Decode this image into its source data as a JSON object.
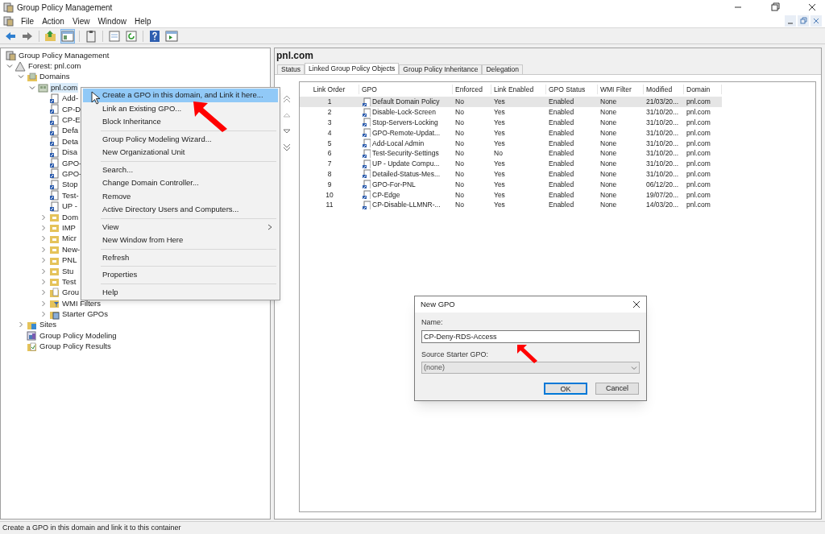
{
  "window": {
    "title": "Group Policy Management"
  },
  "menu_bar": [
    "File",
    "Action",
    "View",
    "Window",
    "Help"
  ],
  "toolbar": [
    {
      "kind": "back",
      "pressed": false
    },
    {
      "kind": "forward",
      "pressed": false
    },
    {
      "kind": "sep"
    },
    {
      "kind": "up",
      "pressed": false
    },
    {
      "kind": "tree",
      "pressed": true
    },
    {
      "kind": "sep"
    },
    {
      "kind": "clipboard",
      "pressed": false
    },
    {
      "kind": "sep"
    },
    {
      "kind": "export",
      "pressed": false
    },
    {
      "kind": "refresh",
      "pressed": false
    },
    {
      "kind": "sep"
    },
    {
      "kind": "help",
      "pressed": false
    },
    {
      "kind": "pane",
      "pressed": false
    }
  ],
  "tree": [
    {
      "label": "Group Policy Management",
      "kind": "root",
      "selected": false,
      "children": [
        {
          "label": "Forest: pnl.com",
          "kind": "forest",
          "expanded": true,
          "selected": false,
          "children": [
            {
              "label": "Domains",
              "kind": "domains",
              "expanded": true,
              "selected": false,
              "children": [
                {
                  "label": "pnl.com",
                  "kind": "domain",
                  "expanded": true,
                  "selected": true,
                  "children": [
                    {
                      "label": "Add-",
                      "kind": "link",
                      "selected": false
                    },
                    {
                      "label": "CP-D",
                      "kind": "link",
                      "selected": false
                    },
                    {
                      "label": "CP-E",
                      "kind": "link",
                      "selected": false
                    },
                    {
                      "label": "Defa",
                      "kind": "link",
                      "selected": false
                    },
                    {
                      "label": "Deta",
                      "kind": "link",
                      "selected": false
                    },
                    {
                      "label": "Disa",
                      "kind": "link",
                      "selected": false
                    },
                    {
                      "label": "GPO-",
                      "kind": "link",
                      "selected": false
                    },
                    {
                      "label": "GPO-",
                      "kind": "link",
                      "selected": false
                    },
                    {
                      "label": "Stop",
                      "kind": "link",
                      "selected": false
                    },
                    {
                      "label": "Test-",
                      "kind": "link",
                      "selected": false
                    },
                    {
                      "label": "UP -",
                      "kind": "link",
                      "selected": false
                    },
                    {
                      "label": "Dom",
                      "kind": "ou",
                      "expanded": false,
                      "selected": false
                    },
                    {
                      "label": "IMP",
                      "kind": "ou",
                      "expanded": false,
                      "selected": false
                    },
                    {
                      "label": "Micr",
                      "kind": "ou",
                      "expanded": false,
                      "selected": false
                    },
                    {
                      "label": "New-",
                      "kind": "ou",
                      "expanded": false,
                      "selected": false
                    },
                    {
                      "label": "PNL",
                      "kind": "ou",
                      "expanded": false,
                      "selected": false
                    },
                    {
                      "label": "Stu",
                      "kind": "ou",
                      "expanded": false,
                      "selected": false
                    },
                    {
                      "label": "Test",
                      "kind": "ou",
                      "expanded": false,
                      "selected": false
                    },
                    {
                      "label": "Grou",
                      "kind": "gpofolder",
                      "expanded": false,
                      "selected": false
                    },
                    {
                      "label": "WMI Filters",
                      "kind": "wmi",
                      "expanded": false,
                      "selected": false
                    },
                    {
                      "label": "Starter GPOs",
                      "kind": "starter",
                      "expanded": false,
                      "selected": false
                    }
                  ]
                }
              ]
            },
            {
              "label": "Sites",
              "kind": "sites",
              "expanded": false,
              "selected": false
            },
            {
              "label": "Group Policy Modeling",
              "kind": "modeling",
              "selected": false
            },
            {
              "label": "Group Policy Results",
              "kind": "results",
              "selected": false
            }
          ]
        }
      ]
    }
  ],
  "details": {
    "title": "pnl.com",
    "tabs": [
      {
        "label": "Status",
        "selected": false
      },
      {
        "label": "Linked Group Policy Objects",
        "selected": true
      },
      {
        "label": "Group Policy Inheritance",
        "selected": false
      },
      {
        "label": "Delegation",
        "selected": false
      }
    ],
    "columns": [
      "Link Order",
      "GPO",
      "Enforced",
      "Link Enabled",
      "GPO Status",
      "WMI Filter",
      "Modified",
      "Domain"
    ],
    "rows": [
      {
        "selected": true,
        "cells": [
          "1",
          "Default Domain Policy",
          "No",
          "Yes",
          "Enabled",
          "None",
          "21/03/20...",
          "pnl.com"
        ]
      },
      {
        "selected": false,
        "cells": [
          "2",
          "Disable-Lock-Screen",
          "No",
          "Yes",
          "Enabled",
          "None",
          "31/10/20...",
          "pnl.com"
        ]
      },
      {
        "selected": false,
        "cells": [
          "3",
          "Stop-Servers-Locking",
          "No",
          "Yes",
          "Enabled",
          "None",
          "31/10/20...",
          "pnl.com"
        ]
      },
      {
        "selected": false,
        "cells": [
          "4",
          "GPO-Remote-Updat...",
          "No",
          "Yes",
          "Enabled",
          "None",
          "31/10/20...",
          "pnl.com"
        ]
      },
      {
        "selected": false,
        "cells": [
          "5",
          "Add-Local Admin",
          "No",
          "Yes",
          "Enabled",
          "None",
          "31/10/20...",
          "pnl.com"
        ]
      },
      {
        "selected": false,
        "cells": [
          "6",
          "Test-Security-Settings",
          "No",
          "No",
          "Enabled",
          "None",
          "31/10/20...",
          "pnl.com"
        ]
      },
      {
        "selected": false,
        "cells": [
          "7",
          "UP - Update Compu...",
          "No",
          "Yes",
          "Enabled",
          "None",
          "31/10/20...",
          "pnl.com"
        ]
      },
      {
        "selected": false,
        "cells": [
          "8",
          "Detailed-Status-Mes...",
          "No",
          "Yes",
          "Enabled",
          "None",
          "31/10/20...",
          "pnl.com"
        ]
      },
      {
        "selected": false,
        "cells": [
          "9",
          "GPO-For-PNL",
          "No",
          "Yes",
          "Enabled",
          "None",
          "06/12/20...",
          "pnl.com"
        ]
      },
      {
        "selected": false,
        "cells": [
          "10",
          "CP-Edge",
          "No",
          "Yes",
          "Enabled",
          "None",
          "19/07/20...",
          "pnl.com"
        ]
      },
      {
        "selected": false,
        "cells": [
          "11",
          "CP-Disable-LLMNR-...",
          "No",
          "Yes",
          "Enabled",
          "None",
          "14/03/20...",
          "pnl.com"
        ]
      }
    ]
  },
  "context_menu": {
    "items": [
      {
        "kind": "item",
        "label": "Create a GPO in this domain, and Link it here...",
        "selected": true
      },
      {
        "kind": "item",
        "label": "Link an Existing GPO...",
        "selected": false
      },
      {
        "kind": "item",
        "label": "Block Inheritance",
        "selected": false
      },
      {
        "kind": "separator"
      },
      {
        "kind": "item",
        "label": "Group Policy Modeling Wizard...",
        "selected": false
      },
      {
        "kind": "item",
        "label": "New Organizational Unit",
        "selected": false
      },
      {
        "kind": "separator"
      },
      {
        "kind": "item",
        "label": "Search...",
        "selected": false
      },
      {
        "kind": "item",
        "label": "Change Domain Controller...",
        "selected": false
      },
      {
        "kind": "item",
        "label": "Remove",
        "selected": false
      },
      {
        "kind": "item",
        "label": "Active Directory Users and Computers...",
        "selected": false
      },
      {
        "kind": "separator"
      },
      {
        "kind": "submenu",
        "label": "View",
        "selected": false
      },
      {
        "kind": "item",
        "label": "New Window from Here",
        "selected": false
      },
      {
        "kind": "separator"
      },
      {
        "kind": "item",
        "label": "Refresh",
        "selected": false
      },
      {
        "kind": "separator"
      },
      {
        "kind": "item",
        "label": "Properties",
        "selected": false
      },
      {
        "kind": "separator"
      },
      {
        "kind": "item",
        "label": "Help",
        "selected": false
      }
    ]
  },
  "dialog": {
    "title": "New GPO",
    "name_label": "Name:",
    "name_value": "CP-Deny-RDS-Access",
    "source_label": "Source Starter GPO:",
    "source_value": "(none)",
    "source_disabled": true,
    "buttons": [
      {
        "label": "OK",
        "default": true
      },
      {
        "label": "Cancel",
        "default": false
      }
    ]
  },
  "status_bar": "Create a GPO in this domain and link it to this container"
}
